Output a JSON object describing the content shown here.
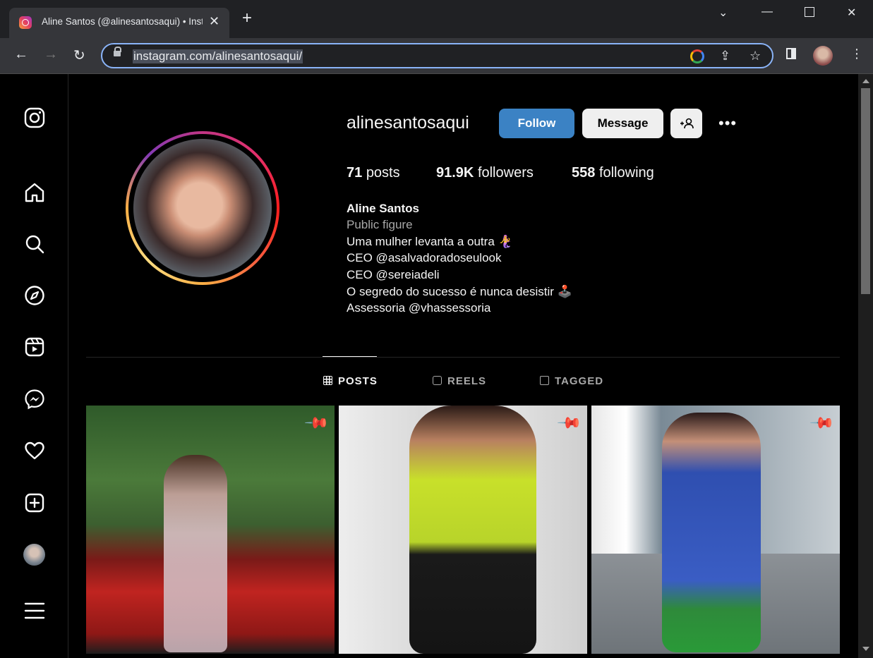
{
  "browser": {
    "tab_title": "Aline Santos (@alinesantosaqui) • Instagram photos and videos",
    "url": "instagram.com/alinesantosaqui/"
  },
  "profile": {
    "username": "alinesantosaqui",
    "follow_label": "Follow",
    "message_label": "Message",
    "more_label": "•••",
    "posts_count": "71",
    "posts_label": "posts",
    "followers_count": "91.9K",
    "followers_label": "followers",
    "following_count": "558",
    "following_label": "following",
    "full_name": "Aline Santos",
    "category": "Public figure",
    "bio_lines": [
      "Uma mulher levanta a outra 🧜‍♀️",
      "CEO @asalvadoradoseulook",
      "CEO @sereiadeli",
      "O segredo do sucesso é nunca desistir 🕹️",
      "Assessoria @vhassessoria"
    ]
  },
  "tabs": [
    {
      "label": "POSTS",
      "active": true
    },
    {
      "label": "REELS",
      "active": false
    },
    {
      "label": "TAGGED",
      "active": false
    }
  ],
  "posts": [
    {
      "pinned": true
    },
    {
      "pinned": true
    },
    {
      "pinned": true
    }
  ]
}
